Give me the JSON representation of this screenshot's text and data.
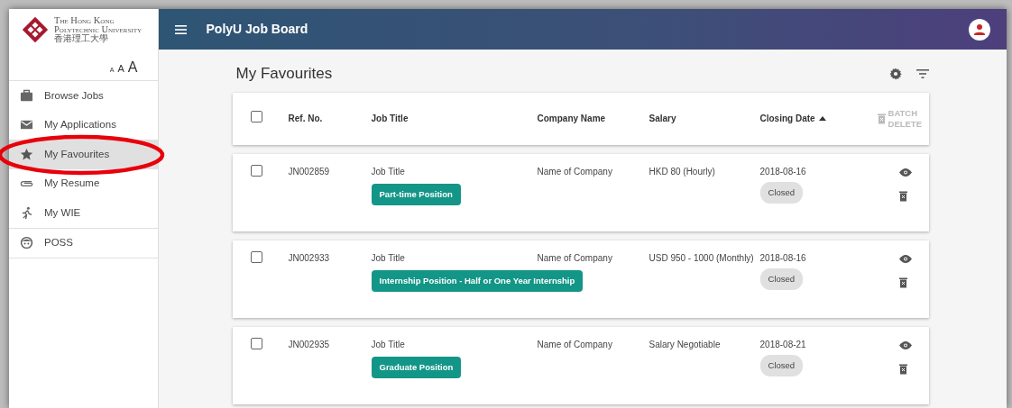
{
  "logo": {
    "lines": [
      "The Hong Kong",
      "Polytechnic University"
    ],
    "chinese": "香港理工大學"
  },
  "font_sizes": [
    "A",
    "A",
    "A"
  ],
  "sidebar": {
    "sections": [
      {
        "items": [
          {
            "label": "Browse Jobs",
            "selected": false,
            "circled": false
          },
          {
            "label": "My Applications",
            "selected": false,
            "circled": false
          },
          {
            "label": "My Favourites",
            "selected": true,
            "circled": true
          },
          {
            "label": "My Resume",
            "selected": false,
            "circled": false
          },
          {
            "label": "My WIE",
            "selected": false,
            "circled": false
          }
        ]
      },
      {
        "items": [
          {
            "label": "POSS",
            "selected": false,
            "circled": false
          }
        ]
      }
    ]
  },
  "header": {
    "title": "PolyU Job Board"
  },
  "page": {
    "title": "My Favourites"
  },
  "table": {
    "select_all_checked": false,
    "columns": [
      {
        "label": "Ref. No.",
        "sorted": false
      },
      {
        "label": "Job Title",
        "sorted": false
      },
      {
        "label": "Company Name",
        "sorted": false
      },
      {
        "label": "Salary",
        "sorted": false
      },
      {
        "label": "Closing Date",
        "sorted": true
      }
    ],
    "batch_action": [
      "BATCH",
      "DELETE"
    ],
    "batch_disabled": true,
    "rows": [
      {
        "ref": "JN002859",
        "title": "Job Title",
        "tag": "Part-time Position",
        "company": "Name of Company",
        "salary": "HKD 80 (Hourly)",
        "date": "2018-08-16",
        "status": "Closed",
        "checked": false
      },
      {
        "ref": "JN002933",
        "title": "Job Title",
        "tag": "Internship Position - Half or One Year Internship",
        "company": "Name of Company",
        "salary": "USD 950 - 1000 (Monthly)",
        "date": "2018-08-16",
        "status": "Closed",
        "checked": false
      },
      {
        "ref": "JN002935",
        "title": "Job Title",
        "tag": "Graduate Position",
        "company": "Name of Company",
        "salary": "Salary Negotiable",
        "date": "2018-08-21",
        "status": "Closed",
        "checked": false
      }
    ]
  }
}
